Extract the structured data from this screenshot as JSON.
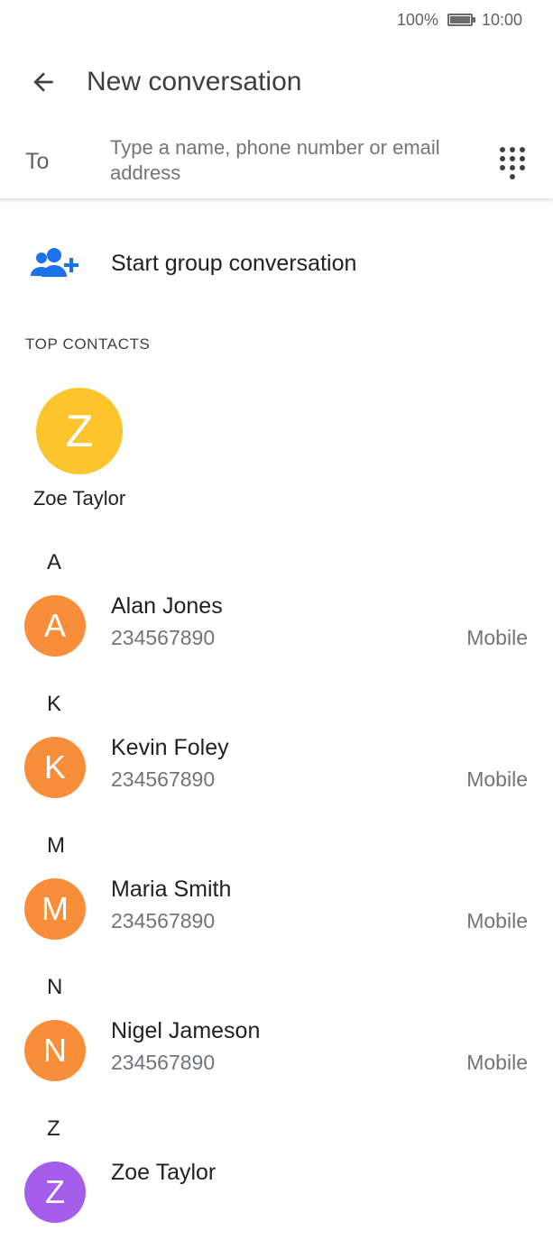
{
  "status_bar": {
    "battery": "100%",
    "time": "10:00"
  },
  "app_bar": {
    "title": "New conversation"
  },
  "recipient": {
    "label": "To",
    "placeholder": "Type a name, phone number or email address"
  },
  "group": {
    "label": "Start group conversation"
  },
  "top_contacts": {
    "header": "TOP CONTACTS",
    "items": [
      {
        "initial": "Z",
        "name": "Zoe Taylor",
        "color": "#FDC52D"
      }
    ]
  },
  "contacts": {
    "sections": [
      {
        "letter": "A",
        "contacts": [
          {
            "initial": "A",
            "name": "Alan Jones",
            "phone": "234567890",
            "type": "Mobile",
            "color": "#F98E3A"
          }
        ]
      },
      {
        "letter": "K",
        "contacts": [
          {
            "initial": "K",
            "name": "Kevin Foley",
            "phone": "234567890",
            "type": "Mobile",
            "color": "#F98E3A"
          }
        ]
      },
      {
        "letter": "M",
        "contacts": [
          {
            "initial": "M",
            "name": "Maria Smith",
            "phone": "234567890",
            "type": "Mobile",
            "color": "#F98E3A"
          }
        ]
      },
      {
        "letter": "N",
        "contacts": [
          {
            "initial": "N",
            "name": "Nigel Jameson",
            "phone": "234567890",
            "type": "Mobile",
            "color": "#F98E3A"
          }
        ]
      },
      {
        "letter": "Z",
        "contacts": [
          {
            "initial": "Z",
            "name": "Zoe Taylor",
            "phone": "",
            "type": "",
            "color": "#A55EEA"
          }
        ]
      }
    ]
  },
  "icons": {
    "back": "arrow-back-icon",
    "dialpad": "dialpad-icon",
    "group": "group-add-icon",
    "battery": "battery-icon"
  },
  "colors": {
    "accent": "#1A73E8"
  }
}
